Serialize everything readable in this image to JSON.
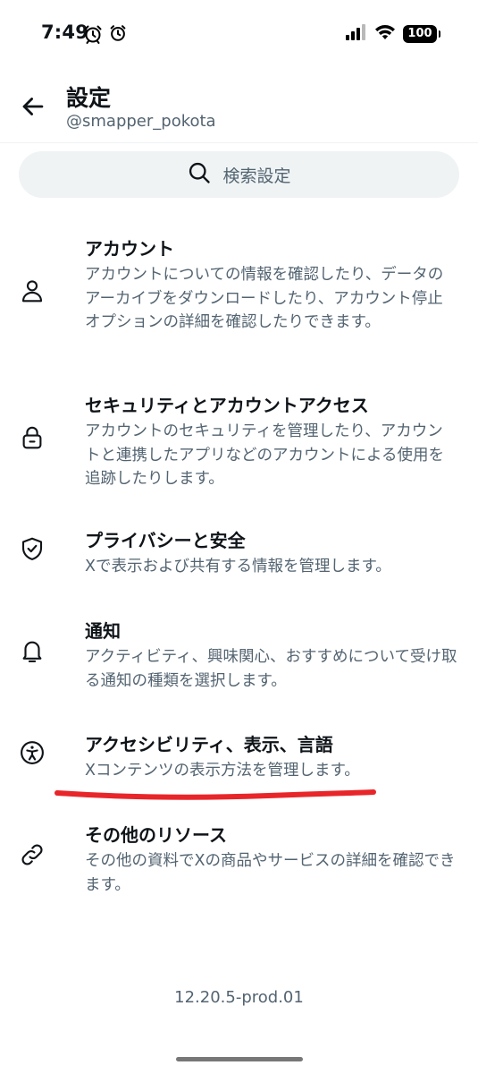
{
  "status_bar": {
    "time": "7:49",
    "battery": "100"
  },
  "header": {
    "title": "設定",
    "username": "@smapper_pokota"
  },
  "search": {
    "label": "検索設定"
  },
  "settings": [
    {
      "icon": "person-icon",
      "title": "アカウント",
      "description": "アカウントについての情報を確認したり、データのアーカイブをダウンロードしたり、アカウント停止オプションの詳細を確認したりできます。"
    },
    {
      "icon": "lock-icon",
      "title": "セキュリティとアカウントアクセス",
      "description": "アカウントのセキュリティを管理したり、アカウントと連携したアプリなどのアカウントによる使用を追跡したりします。"
    },
    {
      "icon": "shield-check-icon",
      "title": "プライバシーと安全",
      "description": "Xで表示および共有する情報を管理します。"
    },
    {
      "icon": "bell-icon",
      "title": "通知",
      "description": "アクティビティ、興味関心、おすすめについて受け取る通知の種類を選択します。"
    },
    {
      "icon": "accessibility-icon",
      "title": "アクセシビリティ、表示、言語",
      "description": "Xコンテンツの表示方法を管理します。"
    },
    {
      "icon": "link-icon",
      "title": "その他のリソース",
      "description": "その他の資料でXの商品やサービスの詳細を確認できます。"
    }
  ],
  "version": "12.20.5-prod.01",
  "colors": {
    "text": "#0f1419",
    "secondary": "#536471",
    "search_bg": "#eff3f4",
    "annotation": "#e8262a"
  }
}
